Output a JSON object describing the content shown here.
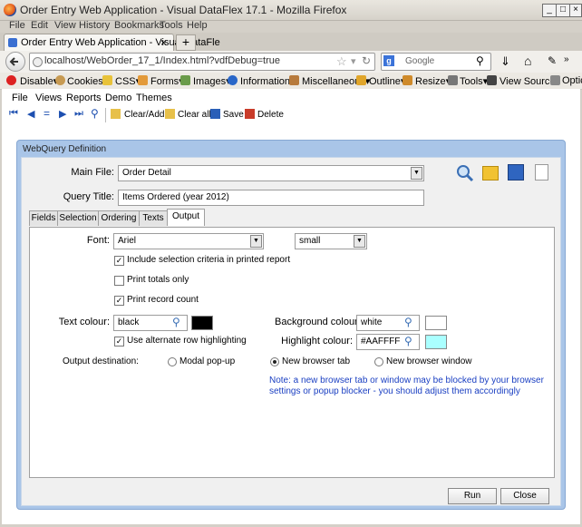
{
  "window": {
    "title": "Order Entry Web Application - Visual DataFlex 17.1 - Mozilla Firefox"
  },
  "browser_menu": [
    "File",
    "Edit",
    "View",
    "History",
    "Bookmarks",
    "Tools",
    "Help"
  ],
  "browser_tab": {
    "label": "Order Entry Web Application - Visual DataFle",
    "close": "×",
    "new": "+"
  },
  "nav": {
    "url": "localhost/WebOrder_17_1/Index.html?vdfDebug=true",
    "search_placeholder": "Google"
  },
  "devbar": [
    "Disable▾",
    "Cookies▾",
    "CSS▾",
    "Forms▾",
    "Images▾",
    "Information▾",
    "Miscellaneous▾",
    "Outline▾",
    "Resize▾",
    "Tools▾",
    "View Source▾",
    "Optic"
  ],
  "app_menu": [
    "File",
    "Views",
    "Reports",
    "Demo",
    "Themes"
  ],
  "app_toolbar": {
    "clear_add": "Clear/Add",
    "clear_all": "Clear all",
    "save": "Save",
    "delete": "Delete"
  },
  "dialog": {
    "title": "WebQuery Definition",
    "main_file_label": "Main File:",
    "main_file_value": "Order Detail",
    "query_title_label": "Query Title:",
    "query_title_value": "Items Ordered (year 2012)",
    "tabs": [
      "Fields",
      "Selection",
      "Ordering",
      "Texts",
      "Output"
    ],
    "output": {
      "font_label": "Font:",
      "font_value": "Ariel",
      "size_value": "small",
      "include_criteria": "Include selection criteria in printed report",
      "print_totals": "Print totals only",
      "print_count": "Print record count",
      "text_colour_label": "Text colour:",
      "text_colour_value": "black",
      "bg_colour_label": "Background colour:",
      "bg_colour_value": "white",
      "alt_rows": "Use alternate row highlighting",
      "highlight_label": "Highlight colour:",
      "highlight_value": "#AAFFFF",
      "dest_label": "Output destination:",
      "dest_modal": "Modal pop-up",
      "dest_tab": "New browser tab",
      "dest_window": "New browser window",
      "note": "Note: a new browser tab or window may be blocked by your browser settings or popup blocker - you should adjust them accordingly"
    },
    "run": "Run",
    "close": "Close"
  },
  "colors": {
    "text_swatch": "#000000",
    "bg_swatch": "#ffffff",
    "highlight_swatch": "#aaffff"
  }
}
